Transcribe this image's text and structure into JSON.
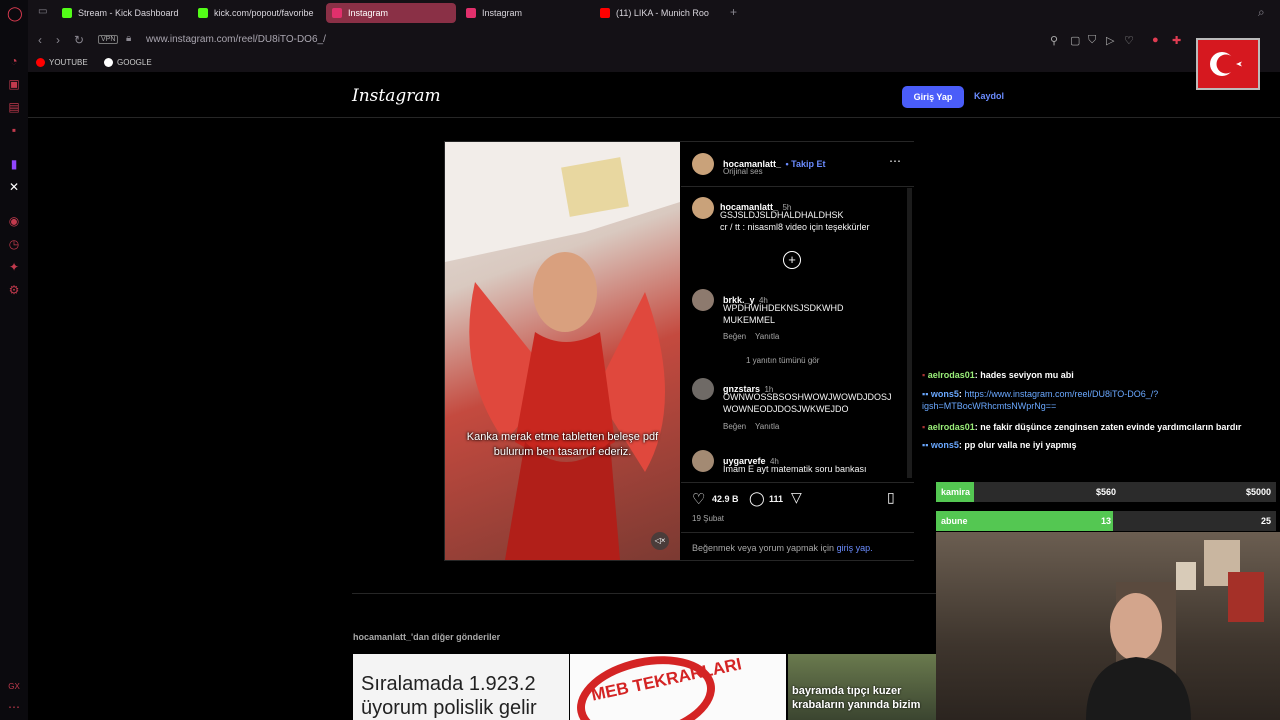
{
  "tabs": [
    {
      "label": "Stream - Kick Dashboard",
      "icon": "kick-icon",
      "color": "#53fc18"
    },
    {
      "label": "kick.com/popout/favoribe",
      "icon": "kick-icon",
      "color": "#53fc18"
    },
    {
      "label": "Instagram",
      "icon": "instagram-icon",
      "color": "#e1306c",
      "active": true
    },
    {
      "label": "Instagram",
      "icon": "instagram-icon",
      "color": "#e1306c"
    },
    {
      "label": "(11) LIKA - Munich Roo",
      "icon": "youtube-icon",
      "color": "#ff0000"
    }
  ],
  "address": {
    "vpn": "VPN",
    "url": "www.instagram.com/reel/DU8iTO-DO6_/"
  },
  "bookmarks": [
    {
      "label": "YOUTUBE"
    },
    {
      "label": "GOOGLE"
    }
  ],
  "instagram": {
    "logo": "Instagram",
    "login_label": "Giriş Yap",
    "signup_label": "Kaydol",
    "post": {
      "overlay_caption": "Kanka merak etme tabletten beleşe pdf bulurum ben tasarruf ederiz.",
      "author": "hocamanlatt_",
      "follow": "• Takip Et",
      "audio": "Orijinal ses",
      "caption": {
        "user": "hocamanlatt_",
        "time": "5h",
        "line1": "GSJSLDJSLDHALDHALDHSK",
        "line2": "cr / tt : nisasml8 video için teşekkürler"
      },
      "comments": [
        {
          "user": "brkk._y",
          "time": "4h",
          "text": "WPDHWİHDEKNSJSDKWHD MUKEMMEL",
          "like": "Beğen",
          "reply": "Yanıtla",
          "replies": "1 yanıtın tümünü gör"
        },
        {
          "user": "gnzstars",
          "time": "1h",
          "text": "OWNWOSSBSOSHWOWJWOWDJDOSJ WOWNEODJDOSJWKWEJDO",
          "like": "Beğen",
          "reply": "Yanıtla"
        },
        {
          "user": "uygarvefe",
          "time": "4h",
          "text": "İmam E ayt matematik soru bankası"
        }
      ],
      "likes": "42.9 B",
      "comments_count": "111",
      "date": "19 Şubat",
      "login_prompt": "Beğenmek veya yorum yapmak için",
      "login_link": "giriş yap."
    },
    "more_posts_title": "hocamanlatt_'dan diğer gönderiler",
    "thumbnails": [
      {
        "text": "Sıralamada 1.923.2 üyorum polislik gelir"
      },
      {
        "text": "MEB TEKRARLARI"
      },
      {
        "text": "bayramda tıpçı kuzer krabaların yanında bizim"
      }
    ]
  },
  "chat": [
    {
      "user": "aelrodas01",
      "msg": ": hades seviyon mu abi",
      "color": "#9bef7a"
    },
    {
      "user": "wons5",
      "msg": ": ",
      "link": "https://www.instagram.com/reel/DU8iTO-DO6_/?igsh=MTBocWRhcmtsNWprNg==",
      "color": "#6aa8ff"
    },
    {
      "user": "aelrodas01",
      "msg": ": ne fakir düşünce zenginsen zaten evinde yardımcıların bardır",
      "color": "#9bef7a"
    },
    {
      "user": "wons5",
      "msg": ": pp olur valla ne iyi yapmış",
      "color": "#6aa8ff"
    }
  ],
  "goals": [
    {
      "label": "kamira",
      "current": "$560",
      "target": "$5000",
      "progress": 0.112
    },
    {
      "label": "abune",
      "current": "13",
      "target": "25",
      "progress": 0.52
    }
  ],
  "colors": {
    "accent": "#4a5df9",
    "active_tab": "#8a3046",
    "goal_fill": "#54c752"
  }
}
